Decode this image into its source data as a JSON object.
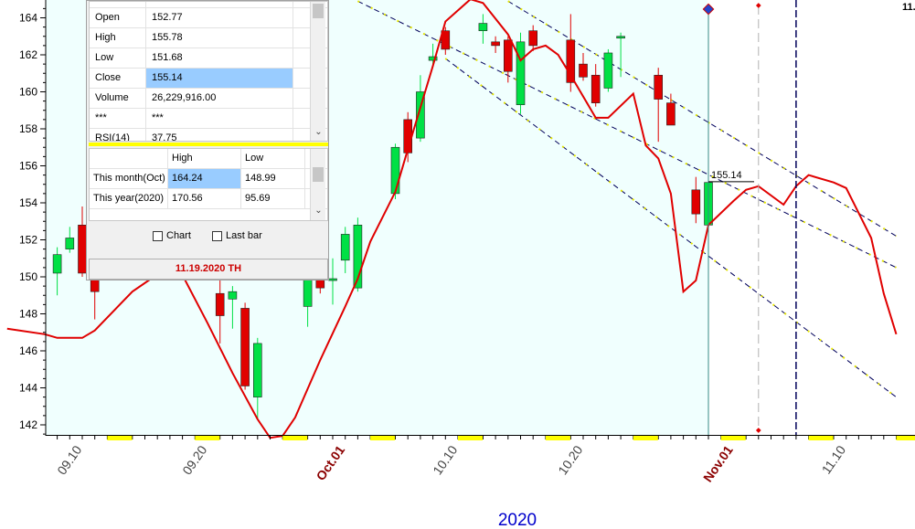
{
  "colors": {
    "up": "#00e045",
    "down": "#e00000",
    "line": "#e00000",
    "plotbg": "#f0fffe",
    "channel": "#00005a",
    "month": "#8b0000",
    "axis": "#000000",
    "yearLabel": "#0000cc"
  },
  "chart_data": {
    "type": "candlestick",
    "x_label": "2020",
    "y_ticks": [
      "142",
      "144",
      "146",
      "148",
      "150",
      "152",
      "154",
      "156",
      "158",
      "160",
      "162",
      "164"
    ],
    "ylim": [
      141,
      165
    ],
    "x_ticks": [
      {
        "label": "09.10",
        "date": "2020-09-10",
        "month": false
      },
      {
        "label": "09.20",
        "date": "2020-09-20",
        "month": false
      },
      {
        "label": "Oct.01",
        "date": "2020-10-01",
        "month": true
      },
      {
        "label": "10.10",
        "date": "2020-10-10",
        "month": false
      },
      {
        "label": "10.20",
        "date": "2020-10-20",
        "month": false
      },
      {
        "label": "Nov.01",
        "date": "2020-11-01",
        "month": true
      },
      {
        "label": "11.10",
        "date": "2020-11-10",
        "month": false
      }
    ],
    "candles": [
      {
        "date": "2020-09-08",
        "o": 150.2,
        "h": 151.6,
        "l": 149.0,
        "c": 151.2
      },
      {
        "date": "2020-09-09",
        "o": 151.5,
        "h": 152.7,
        "l": 151.3,
        "c": 152.1
      },
      {
        "date": "2020-09-10",
        "o": 152.8,
        "h": 153.8,
        "l": 150.0,
        "c": 150.2
      },
      {
        "date": "2020-09-11",
        "o": 150.0,
        "h": 150.8,
        "l": 147.7,
        "c": 149.2
      },
      {
        "date": "2020-09-21",
        "o": 149.1,
        "h": 150.3,
        "l": 146.4,
        "c": 147.9
      },
      {
        "date": "2020-09-22",
        "o": 148.8,
        "h": 149.5,
        "l": 147.2,
        "c": 149.2
      },
      {
        "date": "2020-09-23",
        "o": 148.3,
        "h": 148.6,
        "l": 143.9,
        "c": 144.1
      },
      {
        "date": "2020-09-24",
        "o": 143.5,
        "h": 146.7,
        "l": 142.3,
        "c": 146.4
      },
      {
        "date": "2020-09-28",
        "o": 148.4,
        "h": 150.6,
        "l": 147.3,
        "c": 150.2
      },
      {
        "date": "2020-09-29",
        "o": 150.3,
        "h": 151.2,
        "l": 149.1,
        "c": 149.4
      },
      {
        "date": "2020-09-30",
        "o": 149.8,
        "h": 151.0,
        "l": 148.5,
        "c": 149.9
      },
      {
        "date": "2020-10-01",
        "o": 150.9,
        "h": 152.7,
        "l": 150.2,
        "c": 152.3
      },
      {
        "date": "2020-10-02",
        "o": 149.4,
        "h": 153.2,
        "l": 149.2,
        "c": 152.8
      },
      {
        "date": "2020-10-05",
        "o": 154.5,
        "h": 157.2,
        "l": 154.2,
        "c": 157.0
      },
      {
        "date": "2020-10-06",
        "o": 158.5,
        "h": 158.9,
        "l": 156.2,
        "c": 156.7
      },
      {
        "date": "2020-10-07",
        "o": 157.5,
        "h": 160.9,
        "l": 157.3,
        "c": 160.0
      },
      {
        "date": "2020-10-08",
        "o": 161.7,
        "h": 162.6,
        "l": 161.5,
        "c": 161.9
      },
      {
        "date": "2020-10-09",
        "o": 163.3,
        "h": 163.5,
        "l": 162.0,
        "c": 162.3
      },
      {
        "date": "2020-10-12",
        "o": 163.3,
        "h": 164.2,
        "l": 162.6,
        "c": 163.7
      },
      {
        "date": "2020-10-13",
        "o": 162.7,
        "h": 163.0,
        "l": 162.1,
        "c": 162.5
      },
      {
        "date": "2020-10-14",
        "o": 162.8,
        "h": 163.0,
        "l": 160.5,
        "c": 161.1
      },
      {
        "date": "2020-10-15",
        "o": 159.3,
        "h": 163.2,
        "l": 158.8,
        "c": 162.7
      },
      {
        "date": "2020-10-16",
        "o": 163.3,
        "h": 163.6,
        "l": 162.2,
        "c": 162.5
      },
      {
        "date": "2020-10-19",
        "o": 162.8,
        "h": 164.2,
        "l": 160.0,
        "c": 160.5
      },
      {
        "date": "2020-10-20",
        "o": 161.5,
        "h": 162.1,
        "l": 160.6,
        "c": 160.8
      },
      {
        "date": "2020-10-21",
        "o": 160.9,
        "h": 161.5,
        "l": 159.2,
        "c": 159.4
      },
      {
        "date": "2020-10-22",
        "o": 160.2,
        "h": 162.3,
        "l": 160.0,
        "c": 162.1
      },
      {
        "date": "2020-10-23",
        "o": 163.0,
        "h": 163.2,
        "l": 160.8,
        "c": 163.0
      },
      {
        "date": "2020-10-26",
        "o": 160.9,
        "h": 161.3,
        "l": 157.3,
        "c": 159.6
      },
      {
        "date": "2020-10-27",
        "o": 159.4,
        "h": 159.9,
        "l": 158.2,
        "c": 158.2
      },
      {
        "date": "2020-10-29",
        "o": 154.7,
        "h": 155.4,
        "l": 152.9,
        "c": 153.4
      },
      {
        "date": "2020-10-30",
        "o": 152.8,
        "h": 155.5,
        "l": 151.7,
        "c": 155.1
      }
    ],
    "indicator_line": [
      {
        "date": "2020-09-04",
        "v": 147.2
      },
      {
        "date": "2020-09-07",
        "v": 146.9
      },
      {
        "date": "2020-09-08",
        "v": 146.7
      },
      {
        "date": "2020-09-10",
        "v": 146.7
      },
      {
        "date": "2020-09-11",
        "v": 147.1
      },
      {
        "date": "2020-09-14",
        "v": 149.2
      },
      {
        "date": "2020-09-17",
        "v": 150.6
      },
      {
        "date": "2020-09-18",
        "v": 150.1
      },
      {
        "date": "2020-09-20",
        "v": 147.5
      },
      {
        "date": "2020-09-22",
        "v": 144.8
      },
      {
        "date": "2020-09-24",
        "v": 142.3
      },
      {
        "date": "2020-09-25",
        "v": 141.3
      },
      {
        "date": "2020-09-26",
        "v": 141.4
      },
      {
        "date": "2020-09-27",
        "v": 142.4
      },
      {
        "date": "2020-09-29",
        "v": 145.5
      },
      {
        "date": "2020-10-01",
        "v": 148.4
      },
      {
        "date": "2020-10-02",
        "v": 149.9
      },
      {
        "date": "2020-10-03",
        "v": 151.9
      },
      {
        "date": "2020-10-05",
        "v": 154.6
      },
      {
        "date": "2020-10-06",
        "v": 156.9
      },
      {
        "date": "2020-10-08",
        "v": 161.4
      },
      {
        "date": "2020-10-09",
        "v": 163.8
      },
      {
        "date": "2020-10-11",
        "v": 165.0
      },
      {
        "date": "2020-10-12",
        "v": 164.8
      },
      {
        "date": "2020-10-14",
        "v": 163.1
      },
      {
        "date": "2020-10-15",
        "v": 161.7
      },
      {
        "date": "2020-10-16",
        "v": 162.3
      },
      {
        "date": "2020-10-17",
        "v": 162.5
      },
      {
        "date": "2020-10-18",
        "v": 162.0
      },
      {
        "date": "2020-10-19",
        "v": 160.9
      },
      {
        "date": "2020-10-21",
        "v": 158.6
      },
      {
        "date": "2020-10-22",
        "v": 158.6
      },
      {
        "date": "2020-10-24",
        "v": 159.9
      },
      {
        "date": "2020-10-25",
        "v": 157.1
      },
      {
        "date": "2020-10-26",
        "v": 156.4
      },
      {
        "date": "2020-10-27",
        "v": 154.5
      },
      {
        "date": "2020-10-28",
        "v": 149.2
      },
      {
        "date": "2020-10-29",
        "v": 149.8
      },
      {
        "date": "2020-10-30",
        "v": 152.8
      },
      {
        "date": "2020-11-01",
        "v": 154.1
      },
      {
        "date": "2020-11-02",
        "v": 154.7
      },
      {
        "date": "2020-11-03",
        "v": 154.9
      },
      {
        "date": "2020-11-05",
        "v": 153.9
      },
      {
        "date": "2020-11-06",
        "v": 154.9
      },
      {
        "date": "2020-11-07",
        "v": 155.5
      },
      {
        "date": "2020-11-09",
        "v": 155.1
      },
      {
        "date": "2020-11-10",
        "v": 154.8
      },
      {
        "date": "2020-11-12",
        "v": 152.1
      },
      {
        "date": "2020-11-13",
        "v": 149.1
      },
      {
        "date": "2020-11-14",
        "v": 146.9
      }
    ],
    "channel_lines": [
      {
        "from": {
          "date": "2020-10-02",
          "v": 164.9
        },
        "to": {
          "date": "2020-11-14",
          "v": 150.5
        }
      },
      {
        "from": {
          "date": "2020-10-09",
          "v": 161.8
        },
        "to": {
          "date": "2020-11-14",
          "v": 143.5
        }
      },
      {
        "from": {
          "date": "2020-10-14",
          "v": 164.9
        },
        "to": {
          "date": "2020-11-14",
          "v": 152.2
        }
      }
    ],
    "last_price_label": "155.14",
    "last_price": 155.14,
    "cursor_date": "2020-10-30",
    "marker_dates": [
      "2020-11-03",
      "2020-11-06"
    ],
    "corner_label": "11."
  },
  "panel": {
    "quote_rows": [
      {
        "label": "Open",
        "value": "152.77"
      },
      {
        "label": "High",
        "value": "155.78"
      },
      {
        "label": "Low",
        "value": "151.68"
      },
      {
        "label": "Close",
        "value": "155.14"
      },
      {
        "label": "Volume",
        "value": "26,229,916.00"
      },
      {
        "label": "***",
        "value": "***"
      },
      {
        "label": "RSI(14)",
        "value": "37.75"
      }
    ],
    "range_header": {
      "blank": "",
      "high": "High",
      "low": "Low"
    },
    "range_rows": [
      {
        "label": "This month(Oct)",
        "high": "164.24",
        "low": "148.99"
      },
      {
        "label": "This year(2020)",
        "high": "170.56",
        "low": "95.69"
      }
    ],
    "chart_checkbox": "Chart",
    "lastbar_checkbox": "Last bar",
    "date_text": "11.19.2020 TH"
  }
}
